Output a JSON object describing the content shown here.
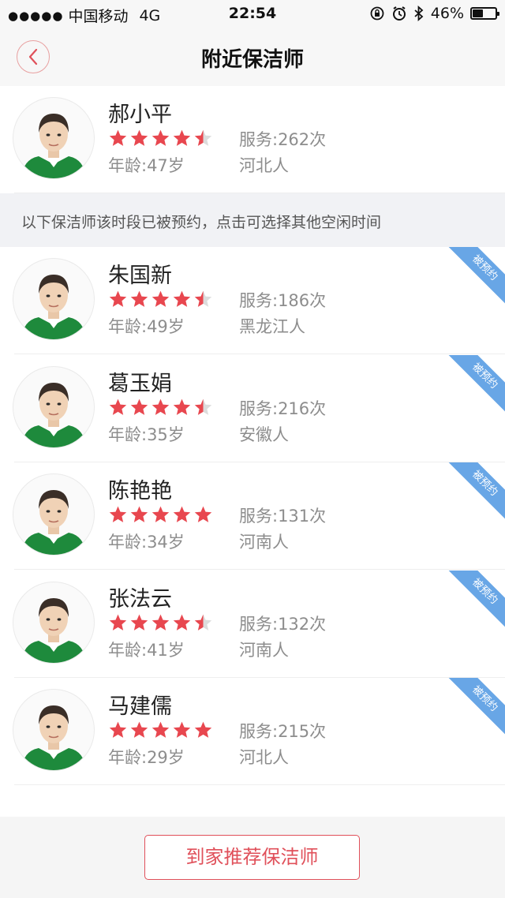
{
  "status_bar": {
    "carrier": "中国移动",
    "network": "4G",
    "time": "22:54",
    "battery": "46%",
    "battery_level": 0.46
  },
  "nav": {
    "title": "附近保洁师",
    "back_icon": "chevron-left-icon"
  },
  "available": [
    {
      "name": "郝小平",
      "rating": 4.5,
      "service": "服务:262次",
      "age": "年龄:47岁",
      "hometown": "河北人"
    }
  ],
  "notice": "以下保洁师该时段已被预约，点击可选择其他空闲时间",
  "booked": [
    {
      "name": "朱国新",
      "rating": 4.5,
      "service": "服务:186次",
      "age": "年龄:49岁",
      "hometown": "黑龙江人",
      "badge": "被预约"
    },
    {
      "name": "葛玉娟",
      "rating": 4.5,
      "service": "服务:216次",
      "age": "年龄:35岁",
      "hometown": "安徽人",
      "badge": "被预约"
    },
    {
      "name": "陈艳艳",
      "rating": 5,
      "service": "服务:131次",
      "age": "年龄:34岁",
      "hometown": "河南人",
      "badge": "被预约"
    },
    {
      "name": "张法云",
      "rating": 4.5,
      "service": "服务:132次",
      "age": "年龄:41岁",
      "hometown": "河南人",
      "badge": "被预约"
    },
    {
      "name": "马建儒",
      "rating": 5,
      "service": "服务:215次",
      "age": "年龄:29岁",
      "hometown": "河北人",
      "badge": "被预约"
    }
  ],
  "bottom": {
    "button_label": "到家推荐保洁师"
  },
  "colors": {
    "star": "#e8474f",
    "star_empty": "#dcdcdc",
    "ribbon": "#68a6e6",
    "button_accent": "#e0505a",
    "uniform": "#1e8a3c"
  }
}
